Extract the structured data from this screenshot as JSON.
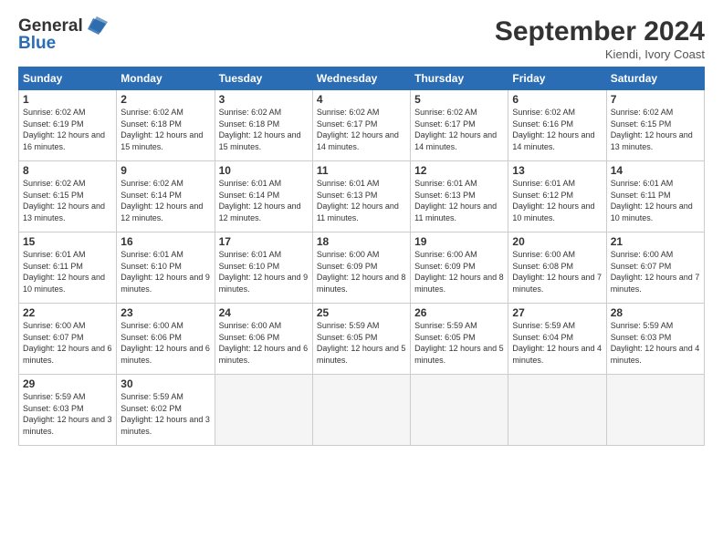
{
  "logo": {
    "line1": "General",
    "line2": "Blue"
  },
  "title": "September 2024",
  "location": "Kiendi, Ivory Coast",
  "days_of_week": [
    "Sunday",
    "Monday",
    "Tuesday",
    "Wednesday",
    "Thursday",
    "Friday",
    "Saturday"
  ],
  "weeks": [
    [
      {
        "day": 1,
        "sunrise": "6:02 AM",
        "sunset": "6:19 PM",
        "daylight": "12 hours and 16 minutes."
      },
      {
        "day": 2,
        "sunrise": "6:02 AM",
        "sunset": "6:18 PM",
        "daylight": "12 hours and 15 minutes."
      },
      {
        "day": 3,
        "sunrise": "6:02 AM",
        "sunset": "6:18 PM",
        "daylight": "12 hours and 15 minutes."
      },
      {
        "day": 4,
        "sunrise": "6:02 AM",
        "sunset": "6:17 PM",
        "daylight": "12 hours and 14 minutes."
      },
      {
        "day": 5,
        "sunrise": "6:02 AM",
        "sunset": "6:17 PM",
        "daylight": "12 hours and 14 minutes."
      },
      {
        "day": 6,
        "sunrise": "6:02 AM",
        "sunset": "6:16 PM",
        "daylight": "12 hours and 14 minutes."
      },
      {
        "day": 7,
        "sunrise": "6:02 AM",
        "sunset": "6:15 PM",
        "daylight": "12 hours and 13 minutes."
      }
    ],
    [
      {
        "day": 8,
        "sunrise": "6:02 AM",
        "sunset": "6:15 PM",
        "daylight": "12 hours and 13 minutes."
      },
      {
        "day": 9,
        "sunrise": "6:02 AM",
        "sunset": "6:14 PM",
        "daylight": "12 hours and 12 minutes."
      },
      {
        "day": 10,
        "sunrise": "6:01 AM",
        "sunset": "6:14 PM",
        "daylight": "12 hours and 12 minutes."
      },
      {
        "day": 11,
        "sunrise": "6:01 AM",
        "sunset": "6:13 PM",
        "daylight": "12 hours and 11 minutes."
      },
      {
        "day": 12,
        "sunrise": "6:01 AM",
        "sunset": "6:13 PM",
        "daylight": "12 hours and 11 minutes."
      },
      {
        "day": 13,
        "sunrise": "6:01 AM",
        "sunset": "6:12 PM",
        "daylight": "12 hours and 10 minutes."
      },
      {
        "day": 14,
        "sunrise": "6:01 AM",
        "sunset": "6:11 PM",
        "daylight": "12 hours and 10 minutes."
      }
    ],
    [
      {
        "day": 15,
        "sunrise": "6:01 AM",
        "sunset": "6:11 PM",
        "daylight": "12 hours and 10 minutes."
      },
      {
        "day": 16,
        "sunrise": "6:01 AM",
        "sunset": "6:10 PM",
        "daylight": "12 hours and 9 minutes."
      },
      {
        "day": 17,
        "sunrise": "6:01 AM",
        "sunset": "6:10 PM",
        "daylight": "12 hours and 9 minutes."
      },
      {
        "day": 18,
        "sunrise": "6:00 AM",
        "sunset": "6:09 PM",
        "daylight": "12 hours and 8 minutes."
      },
      {
        "day": 19,
        "sunrise": "6:00 AM",
        "sunset": "6:09 PM",
        "daylight": "12 hours and 8 minutes."
      },
      {
        "day": 20,
        "sunrise": "6:00 AM",
        "sunset": "6:08 PM",
        "daylight": "12 hours and 7 minutes."
      },
      {
        "day": 21,
        "sunrise": "6:00 AM",
        "sunset": "6:07 PM",
        "daylight": "12 hours and 7 minutes."
      }
    ],
    [
      {
        "day": 22,
        "sunrise": "6:00 AM",
        "sunset": "6:07 PM",
        "daylight": "12 hours and 6 minutes."
      },
      {
        "day": 23,
        "sunrise": "6:00 AM",
        "sunset": "6:06 PM",
        "daylight": "12 hours and 6 minutes."
      },
      {
        "day": 24,
        "sunrise": "6:00 AM",
        "sunset": "6:06 PM",
        "daylight": "12 hours and 6 minutes."
      },
      {
        "day": 25,
        "sunrise": "5:59 AM",
        "sunset": "6:05 PM",
        "daylight": "12 hours and 5 minutes."
      },
      {
        "day": 26,
        "sunrise": "5:59 AM",
        "sunset": "6:05 PM",
        "daylight": "12 hours and 5 minutes."
      },
      {
        "day": 27,
        "sunrise": "5:59 AM",
        "sunset": "6:04 PM",
        "daylight": "12 hours and 4 minutes."
      },
      {
        "day": 28,
        "sunrise": "5:59 AM",
        "sunset": "6:03 PM",
        "daylight": "12 hours and 4 minutes."
      }
    ],
    [
      {
        "day": 29,
        "sunrise": "5:59 AM",
        "sunset": "6:03 PM",
        "daylight": "12 hours and 3 minutes."
      },
      {
        "day": 30,
        "sunrise": "5:59 AM",
        "sunset": "6:02 PM",
        "daylight": "12 hours and 3 minutes."
      },
      null,
      null,
      null,
      null,
      null
    ]
  ]
}
